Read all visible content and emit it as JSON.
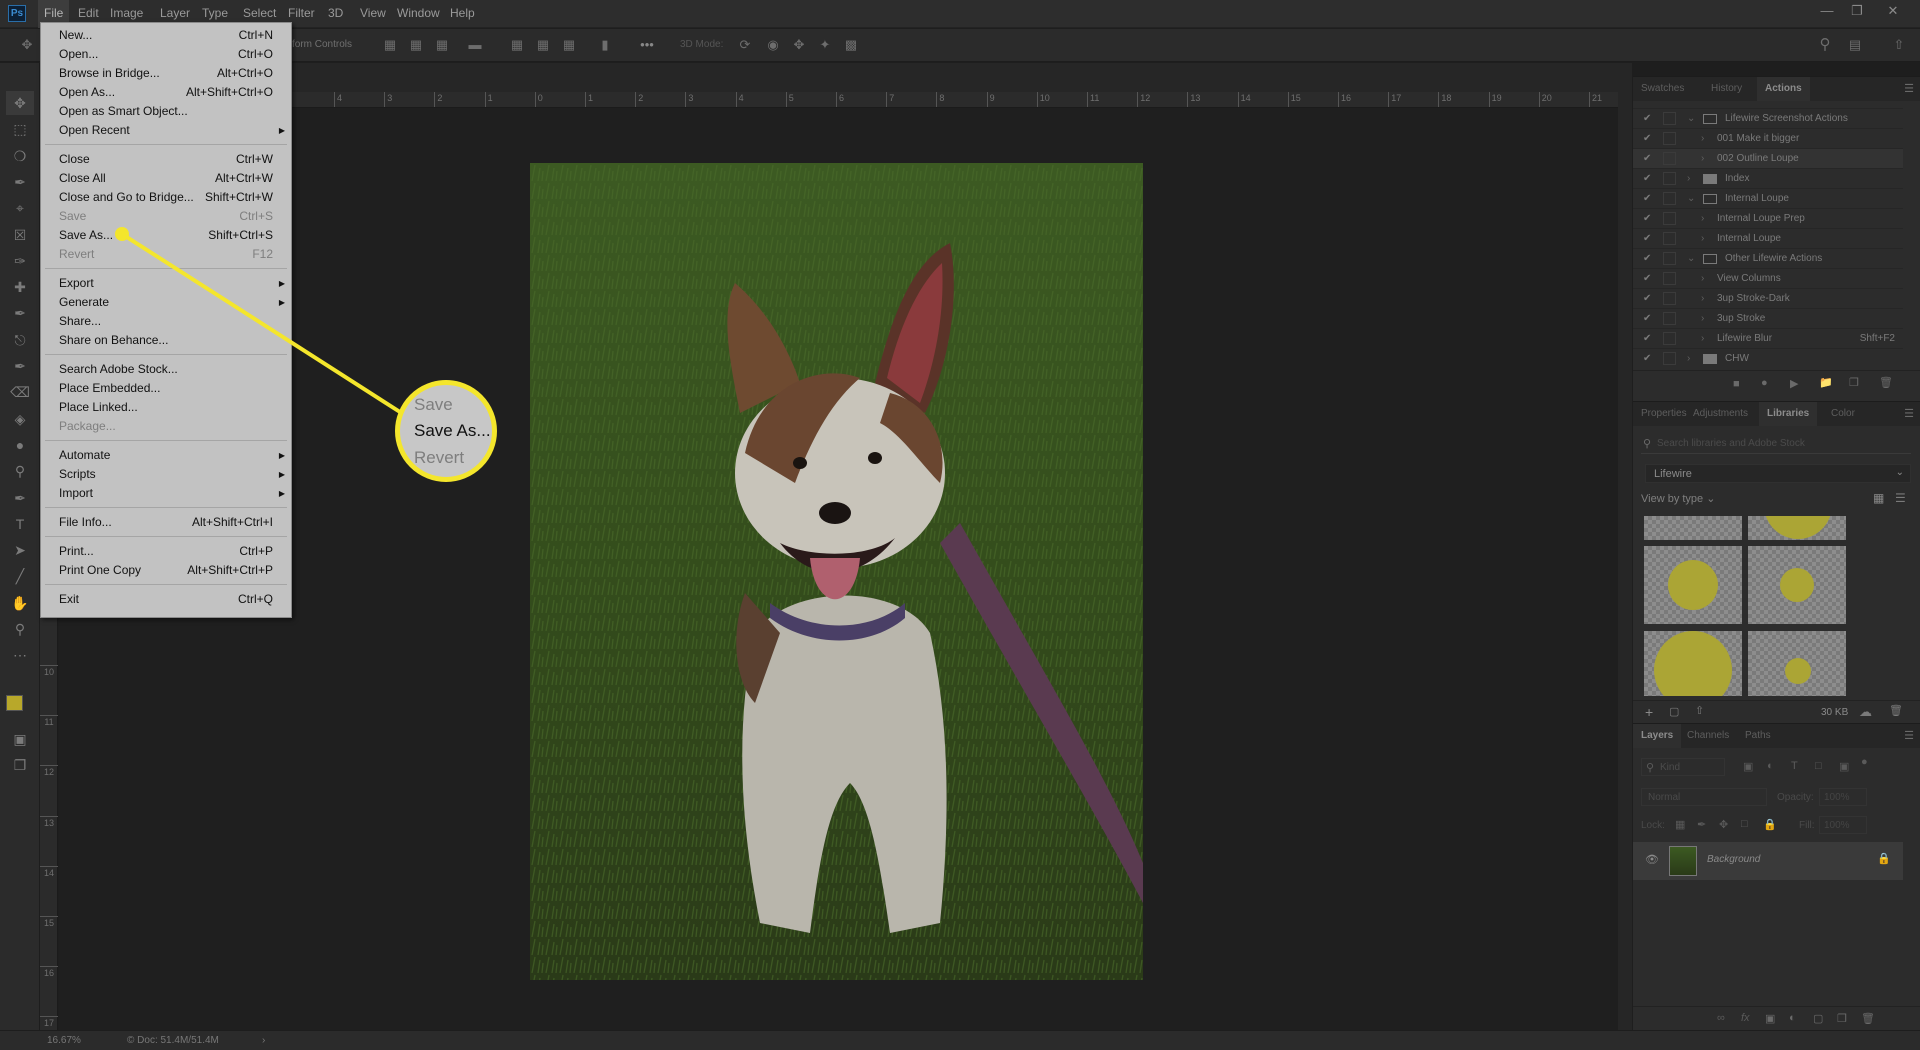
{
  "app": {
    "logo": "Ps",
    "accent": "#f4e62c"
  },
  "menubar": {
    "items": [
      "File",
      "Edit",
      "Image",
      "Layer",
      "Type",
      "Select",
      "Filter",
      "3D",
      "View",
      "Window",
      "Help"
    ],
    "active": "File"
  },
  "window_controls": {
    "minimize": "minimize-icon",
    "restore": "restore-icon",
    "close": "close-icon"
  },
  "options_bar": {
    "transform_controls": "form Controls",
    "three_d_mode": "3D Mode:",
    "more": "•••"
  },
  "ruler": {
    "h": [
      "4",
      "3",
      "2",
      "1",
      "0",
      "1",
      "2",
      "3",
      "4",
      "5",
      "6",
      "7",
      "8",
      "9",
      "10",
      "11",
      "12",
      "13",
      "14",
      "15",
      "16",
      "17",
      "18",
      "19",
      "20",
      "21"
    ],
    "v": [
      "10",
      "11",
      "12",
      "13",
      "14",
      "15",
      "16",
      "17"
    ]
  },
  "file_menu": {
    "groups": [
      [
        {
          "label": "New...",
          "shortcut": "Ctrl+N"
        },
        {
          "label": "Open...",
          "shortcut": "Ctrl+O"
        },
        {
          "label": "Browse in Bridge...",
          "shortcut": "Alt+Ctrl+O"
        },
        {
          "label": "Open As...",
          "shortcut": "Alt+Shift+Ctrl+O"
        },
        {
          "label": "Open as Smart Object...",
          "shortcut": ""
        },
        {
          "label": "Open Recent",
          "shortcut": "",
          "submenu": true
        }
      ],
      [
        {
          "label": "Close",
          "shortcut": "Ctrl+W"
        },
        {
          "label": "Close All",
          "shortcut": "Alt+Ctrl+W"
        },
        {
          "label": "Close and Go to Bridge...",
          "shortcut": "Shift+Ctrl+W"
        },
        {
          "label": "Save",
          "shortcut": "Ctrl+S",
          "disabled": true
        },
        {
          "label": "Save As...",
          "shortcut": "Shift+Ctrl+S"
        },
        {
          "label": "Revert",
          "shortcut": "F12",
          "disabled": true
        }
      ],
      [
        {
          "label": "Export",
          "shortcut": "",
          "submenu": true
        },
        {
          "label": "Generate",
          "shortcut": "",
          "submenu": true
        },
        {
          "label": "Share...",
          "shortcut": ""
        },
        {
          "label": "Share on Behance...",
          "shortcut": ""
        }
      ],
      [
        {
          "label": "Search Adobe Stock...",
          "shortcut": ""
        },
        {
          "label": "Place Embedded...",
          "shortcut": ""
        },
        {
          "label": "Place Linked...",
          "shortcut": ""
        },
        {
          "label": "Package...",
          "shortcut": "",
          "disabled": true
        }
      ],
      [
        {
          "label": "Automate",
          "shortcut": "",
          "submenu": true
        },
        {
          "label": "Scripts",
          "shortcut": "",
          "submenu": true
        },
        {
          "label": "Import",
          "shortcut": "",
          "submenu": true
        }
      ],
      [
        {
          "label": "File Info...",
          "shortcut": "Alt+Shift+Ctrl+I"
        }
      ],
      [
        {
          "label": "Print...",
          "shortcut": "Ctrl+P"
        },
        {
          "label": "Print One Copy",
          "shortcut": "Alt+Shift+Ctrl+P"
        }
      ],
      [
        {
          "label": "Exit",
          "shortcut": "Ctrl+Q"
        }
      ]
    ]
  },
  "loupe": {
    "lines": [
      "Save",
      "Save As...",
      "Revert"
    ]
  },
  "actions_panel": {
    "tabs": [
      "Swatches",
      "History",
      "Actions"
    ],
    "active": "Actions",
    "rows": [
      {
        "label": "Lifewire Screenshot Actions",
        "type": "set",
        "open": true
      },
      {
        "label": "001 Make it bigger",
        "type": "action"
      },
      {
        "label": "002 Outline Loupe",
        "type": "action",
        "selected": true
      },
      {
        "label": "Index",
        "type": "set",
        "open": false
      },
      {
        "label": "Internal Loupe",
        "type": "set",
        "open": true
      },
      {
        "label": "Internal Loupe Prep",
        "type": "action"
      },
      {
        "label": "Internal Loupe",
        "type": "action"
      },
      {
        "label": "Other Lifewire Actions",
        "type": "set",
        "open": true
      },
      {
        "label": "View Columns",
        "type": "action"
      },
      {
        "label": "3up Stroke-Dark",
        "type": "action"
      },
      {
        "label": "3up Stroke",
        "type": "action"
      },
      {
        "label": "Lifewire Blur",
        "type": "action",
        "shortcut": "Shft+F2"
      },
      {
        "label": "CHW",
        "type": "set",
        "open": false
      }
    ]
  },
  "libraries_panel": {
    "tabs": [
      "Properties",
      "Adjustments",
      "Libraries",
      "Color"
    ],
    "active": "Libraries",
    "search_placeholder": "Search libraries and Adobe Stock",
    "library": "Lifewire",
    "view_by": "View by type",
    "size": "30 KB",
    "swatch_color": "#aba535"
  },
  "layers_panel": {
    "tabs": [
      "Layers",
      "Channels",
      "Paths"
    ],
    "active": "Layers",
    "kind_placeholder": "Kind",
    "blend": "Normal",
    "opacity_label": "Opacity:",
    "opacity": "100%",
    "lock_label": "Lock:",
    "fill_label": "Fill:",
    "fill": "100%",
    "layers": [
      {
        "name": "Background",
        "visible": true,
        "locked": true
      }
    ]
  },
  "status": {
    "zoom": "16.67%",
    "doc": "Doc: 51.4M/51.4M"
  }
}
